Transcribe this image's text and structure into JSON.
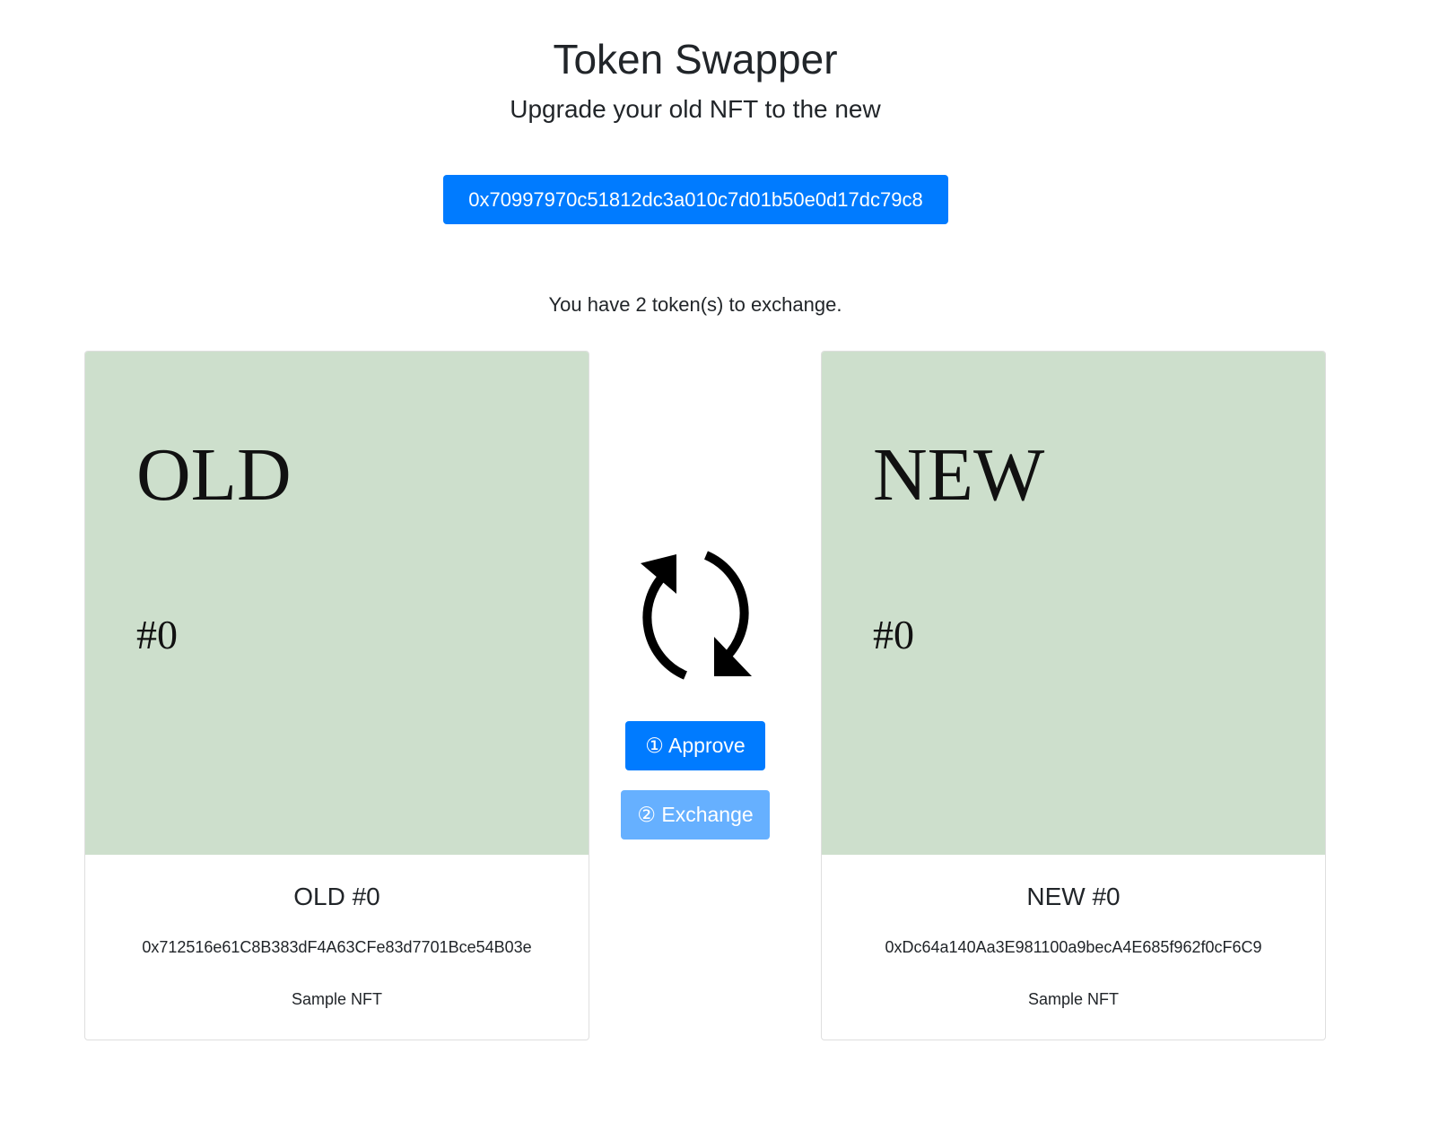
{
  "header": {
    "title": "Token Swapper",
    "subtitle": "Upgrade your old NFT to the new"
  },
  "account": {
    "address": "0x70997970c51812dc3a010c7d01b50e0d17dc79c8"
  },
  "status": {
    "token_count_text": "You have 2 token(s) to exchange."
  },
  "old_card": {
    "image_label": "OLD",
    "image_number": "#0",
    "title": "OLD #0",
    "contract_address": "0x712516e61C8B383dF4A63CFe83d7701Bce54B03e",
    "collection": "Sample NFT"
  },
  "new_card": {
    "image_label": "NEW",
    "image_number": "#0",
    "title": "NEW #0",
    "contract_address": "0xDc64a140Aa3E981100a9becA4E685f962f0cF6C9",
    "collection": "Sample NFT"
  },
  "actions": {
    "swap_icon": "refresh-arrows-icon",
    "approve_label": "① Approve",
    "exchange_label": "② Exchange"
  },
  "colors": {
    "primary": "#007bff",
    "primary_disabled": "#66b0ff",
    "card_image_bg": "#cddfcc",
    "text": "#212529"
  }
}
